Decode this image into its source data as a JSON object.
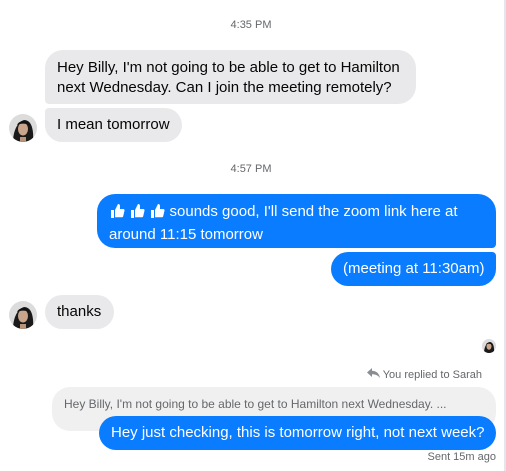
{
  "thread": {
    "timestamp_1": "4:35 PM",
    "timestamp_2": "4:57 PM"
  },
  "messages": {
    "m1_line1": "Hey Billy, I'm not going to be able to get to Hamilton",
    "m1_line2": "next Wednesday.  Can I join the meeting remotely?",
    "m2": "I mean tomorrow",
    "m3_line1": " sounds good, I'll send the zoom link here at",
    "m3_line2": "around 11:15 tomorrow",
    "m4": "(meeting at 11:30am)",
    "m5": "thanks",
    "reply_label": "You replied to Sarah",
    "quoted": "Hey Billy, I'm not going to be able to get to Hamilton next Wednesday.  ...",
    "m6": "Hey just checking, this is tomorrow right, not next week?",
    "status": "Sent 15m ago"
  },
  "icons": {
    "thumbs": "thumbs-up-icon",
    "reply": "reply-arrow-icon",
    "avatar": "contact-avatar",
    "seen": "seen-avatar"
  },
  "colors": {
    "outgoing": "#0a7cff",
    "incoming": "#e9e9eb",
    "meta": "#65676b"
  }
}
